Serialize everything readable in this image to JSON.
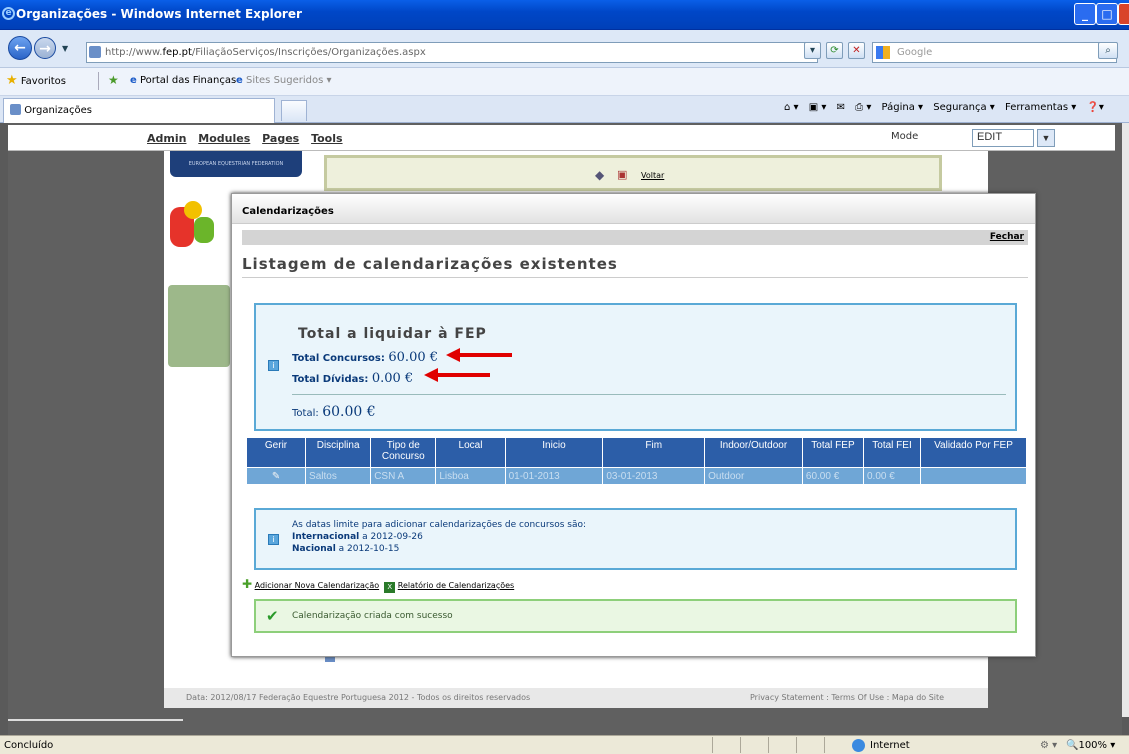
{
  "window": {
    "title": "Organizações - Windows Internet Explorer"
  },
  "address": {
    "url_prefix": "http://www.",
    "url_host": "fep.pt",
    "url_path": "/FiliaçãoServiços/Inscrições/Organizações.aspx",
    "search_placeholder": "Google"
  },
  "favorites": {
    "favoritos_label": "Favoritos",
    "items": [
      "Portal das Finanças",
      "Sites Sugeridos ▾"
    ]
  },
  "tabs": {
    "active": "Organizações"
  },
  "commandbar": {
    "pagina": "Página ▾",
    "seguranca": "Segurança ▾",
    "ferramentas": "Ferramentas ▾"
  },
  "admin": {
    "menu": [
      "Admin",
      "Modules",
      "Pages",
      "Tools"
    ],
    "mode_label": "Mode",
    "mode_value": "EDIT"
  },
  "site": {
    "fed_logo_text": "EUROPEAN EQUESTRIAN FEDERATION",
    "voltar": "Voltar",
    "footer_left": "Data: 2012/08/17   Federação Equestre Portuguesa 2012 - Todos os direitos reservados",
    "footer_right": "Privacy Statement : Terms Of Use : Mapa do Site"
  },
  "modal": {
    "header": "Calendarizações",
    "close": "Fechar",
    "title": "Listagem de calendarizações existentes",
    "totals": {
      "heading": "Total a liquidar à FEP",
      "concursos_label": "Total Concursos:",
      "concursos_value": "60.00 €",
      "dividas_label": "Total Dívidas:",
      "dividas_value": "0.00 €",
      "total_label": "Total:",
      "total_value": "60.00 €"
    },
    "table": {
      "headers": [
        "Gerir",
        "Disciplina",
        "Tipo de Concurso",
        "Local",
        "Inicio",
        "Fim",
        "Indoor/Outdoor",
        "Total FEP",
        "Total FEI",
        "Validado Por FEP"
      ],
      "rows": [
        [
          "✎",
          "Saltos",
          "CSN A",
          "Lisboa",
          "01-01-2013",
          "03-01-2013",
          "Outdoor",
          "60.00 €",
          "0.00 €",
          ""
        ]
      ]
    },
    "dates": {
      "intro": "As datas limite para adicionar calendarizações de concursos são:",
      "internacional_label": "Internacional",
      "internacional_value": "a 2012-09-26",
      "nacional_label": "Nacional",
      "nacional_value": "a 2012-10-15"
    },
    "links": {
      "add": "Adicionar Nova Calendarização",
      "report": "Relatório de Calendarizações"
    },
    "success": "Calendarização criada com sucesso"
  },
  "status": {
    "left": "Concluído",
    "zone": "Internet",
    "zoom": "100%"
  },
  "colors": {
    "ie_blue": "#0047c8",
    "table_header": "#2c5ea8",
    "table_row": "#6fa6d6",
    "info_border": "#5aa9d6",
    "success_border": "#8dcf7a",
    "arrow_red": "#e00000"
  }
}
